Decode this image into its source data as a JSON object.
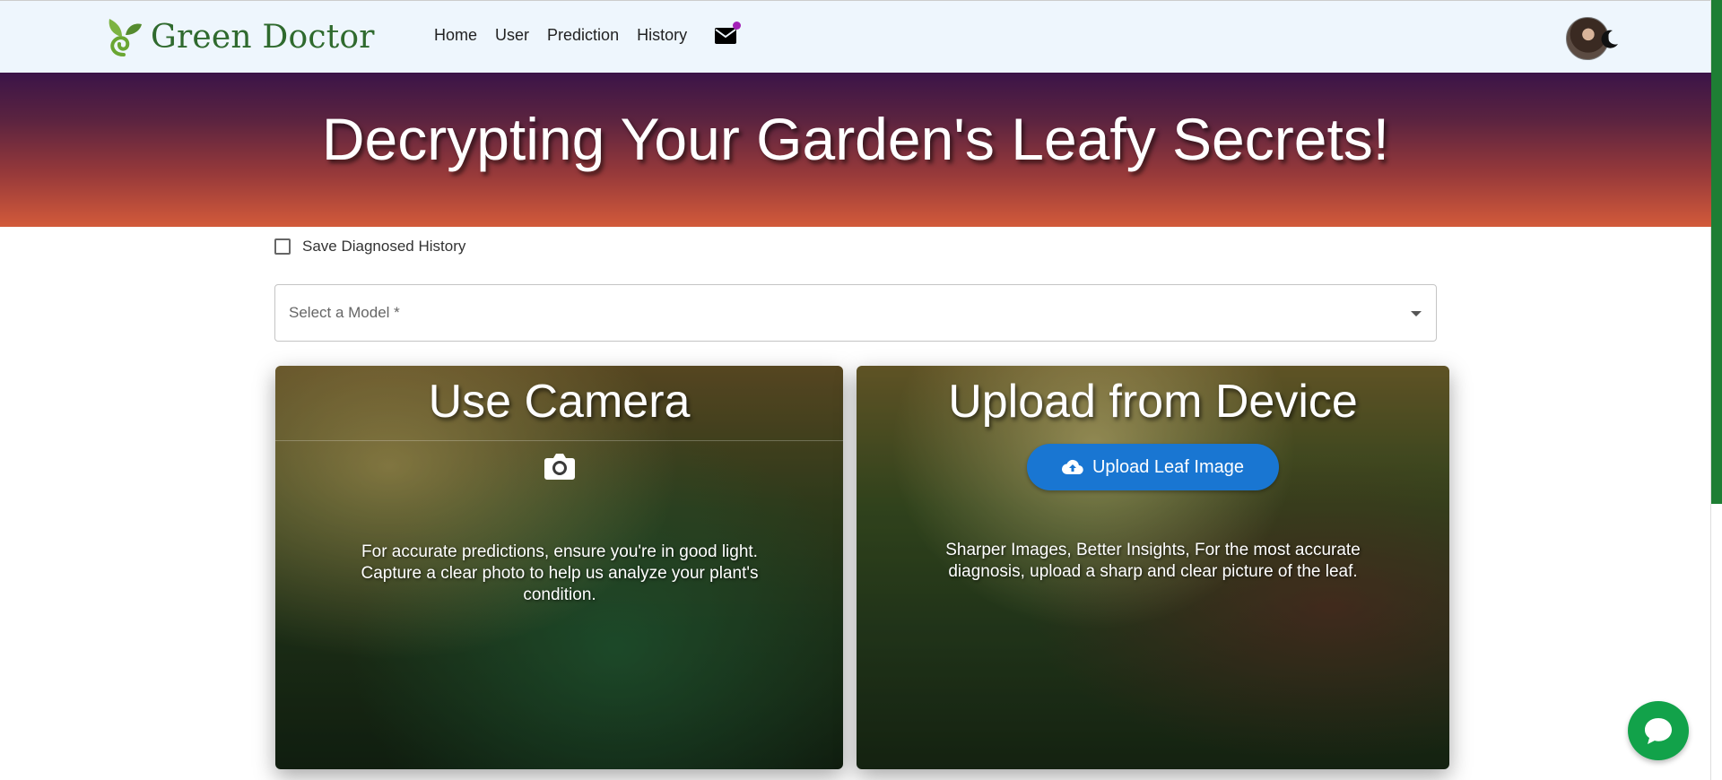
{
  "navbar": {
    "brand": "Green Doctor",
    "links": [
      "Home",
      "User",
      "Prediction",
      "History"
    ],
    "icons": {
      "logo": "sprout-logo-icon",
      "mail": "mail-icon",
      "theme": "moon-icon",
      "avatar": "user-avatar"
    },
    "accent": "#a321b8"
  },
  "hero": {
    "title": "Decrypting Your Garden's Leafy Secrets!"
  },
  "form": {
    "save_history_label": "Save Diagnosed History",
    "model_select_placeholder": "Select a Model *"
  },
  "cards": {
    "camera": {
      "title": "Use Camera",
      "description": "For accurate predictions, ensure you're in good light. Capture a clear photo to help us analyze your plant's condition.",
      "icon": "camera-icon"
    },
    "upload": {
      "title": "Upload from Device",
      "button_label": "Upload Leaf Image",
      "description": "Sharper Images, Better Insights, For the most accurate diagnosis, upload a sharp and clear picture of the leaf.",
      "icon": "cloud-upload-icon"
    }
  },
  "chat": {
    "icon": "chat-bubble-icon",
    "color": "#12a24a"
  },
  "colors": {
    "brand_green": "#2f6a2e",
    "primary_button": "#1976d2",
    "scrollbar": "#1e7e34"
  }
}
